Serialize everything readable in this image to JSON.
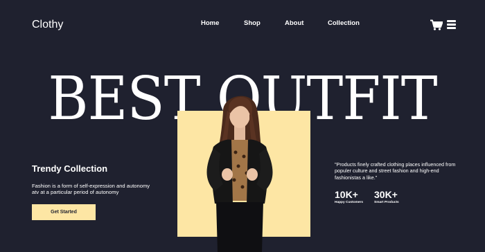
{
  "brand": {
    "name": "Clothy"
  },
  "nav": {
    "items": [
      "Home",
      "Shop",
      "About",
      "Collection"
    ]
  },
  "icons": {
    "cart": "cart-icon",
    "menu": "menu-icon"
  },
  "hero": {
    "headline": "BEST OUTFIT",
    "collection_title": "Trendy Collection",
    "description": "Fashion is a form of self-expression and autonomy atv at a particular period of autonomy",
    "cta_label": "Get Started",
    "quote": "\"Products finely crafted clothing places influenced from populer culture and street fashion and high-end fashionistas a like.\""
  },
  "stats": [
    {
      "value": "10K+",
      "label": "Happy Customers"
    },
    {
      "value": "30K+",
      "label": "Smart Products"
    }
  ],
  "colors": {
    "background": "#1f212f",
    "accent": "#fde6a4",
    "text": "#ffffff"
  }
}
